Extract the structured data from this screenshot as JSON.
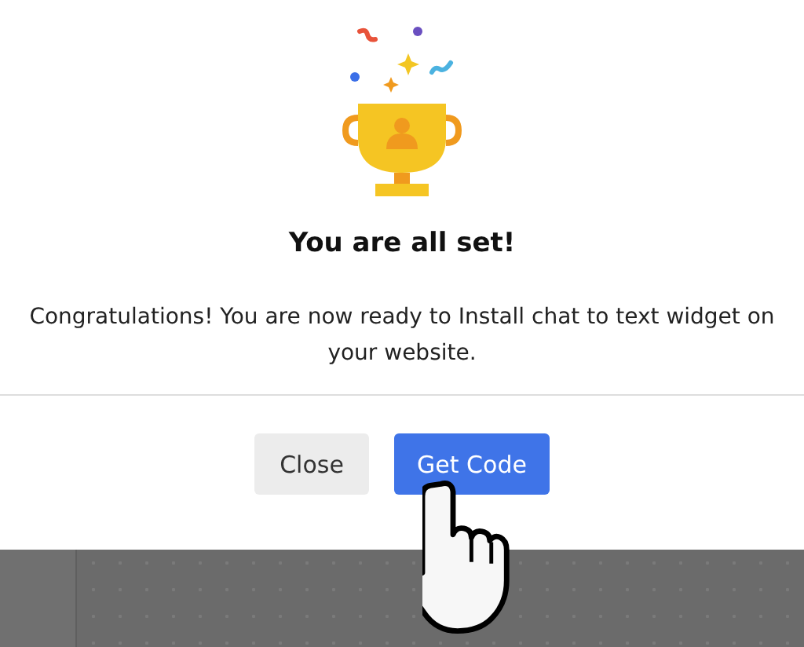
{
  "dialog": {
    "title": "You are all set!",
    "message": "Congratulations! You are now ready to Install chat to text widget on your website.",
    "buttons": [
      {
        "label": "Close",
        "kind": "secondary"
      },
      {
        "label": "Get Code",
        "kind": "primary"
      }
    ]
  }
}
